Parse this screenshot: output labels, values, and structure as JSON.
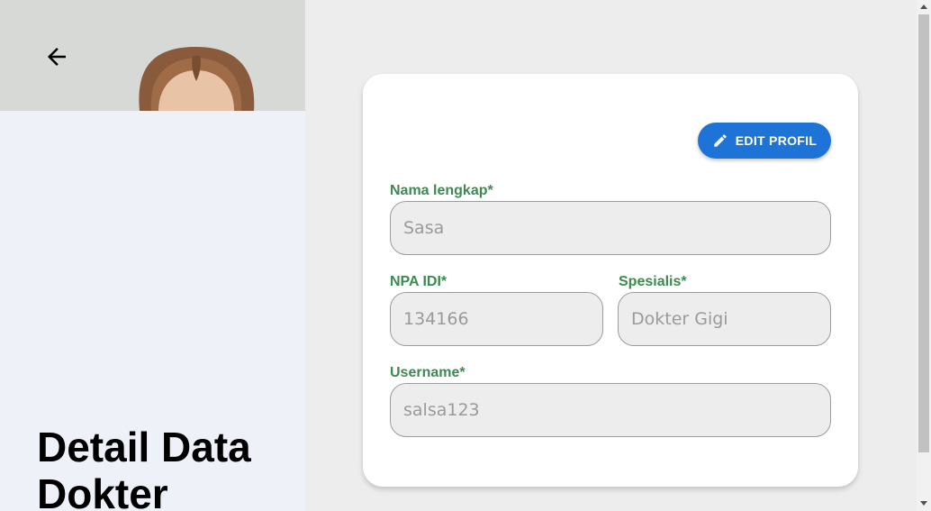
{
  "left_panel": {
    "page_title": "Detail Data Dokter"
  },
  "card": {
    "edit_button_label": "EDIT PROFIL",
    "fields": {
      "nama_lengkap": {
        "label": "Nama lengkap*",
        "value": "Sasa"
      },
      "npa_idi": {
        "label": "NPA IDI*",
        "value": "134166"
      },
      "spesialis": {
        "label": "Spesialis*",
        "value": "Dokter Gigi"
      },
      "username": {
        "label": "Username*",
        "value": "salsa123"
      }
    }
  },
  "icons": {
    "back": "arrow-left-icon",
    "edit": "pencil-icon"
  },
  "colors": {
    "accent_button": "#1e74d6",
    "label_green": "#3c8a4f",
    "input_bg": "#ededed",
    "left_panel_bg": "#eef1f7"
  }
}
